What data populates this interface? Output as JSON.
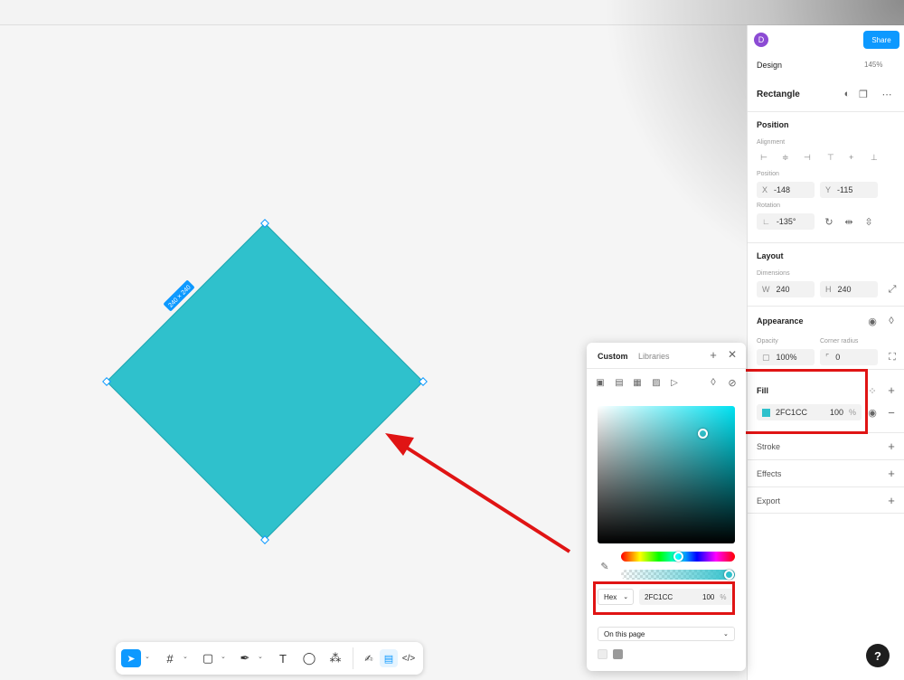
{
  "topbar": {
    "avatar_initial": "D",
    "share_label": "Share"
  },
  "panel": {
    "design_tab": "Design",
    "zoom": "145%",
    "layer_name": "Rectangle",
    "position": {
      "title": "Position",
      "alignment_label": "Alignment",
      "position_label": "Position",
      "x_prefix": "X",
      "x_value": "-148",
      "y_prefix": "Y",
      "y_value": "-115",
      "rotation_label": "Rotation",
      "rotation_value": "-135°"
    },
    "layout": {
      "title": "Layout",
      "dimensions_label": "Dimensions",
      "w_prefix": "W",
      "w_value": "240",
      "h_prefix": "H",
      "h_value": "240"
    },
    "appearance": {
      "title": "Appearance",
      "opacity_label": "Opacity",
      "opacity_value": "100%",
      "radius_label": "Corner radius",
      "radius_value": "0"
    },
    "fill": {
      "title": "Fill",
      "hex": "2FC1CC",
      "opacity": "100",
      "percent": "%"
    },
    "stroke": "Stroke",
    "effects": "Effects",
    "export": "Export"
  },
  "canvas": {
    "shape_color": "#2FC1CC",
    "size_badge": "240 × 240"
  },
  "picker": {
    "tab_custom": "Custom",
    "tab_libraries": "Libraries",
    "format": "Hex",
    "hex": "2FC1CC",
    "opacity": "100",
    "percent": "%",
    "scope": "On this page"
  },
  "colors": {
    "accent": "#0D99FF",
    "highlight": "#E01414",
    "swatch": "#2FC1CC"
  }
}
